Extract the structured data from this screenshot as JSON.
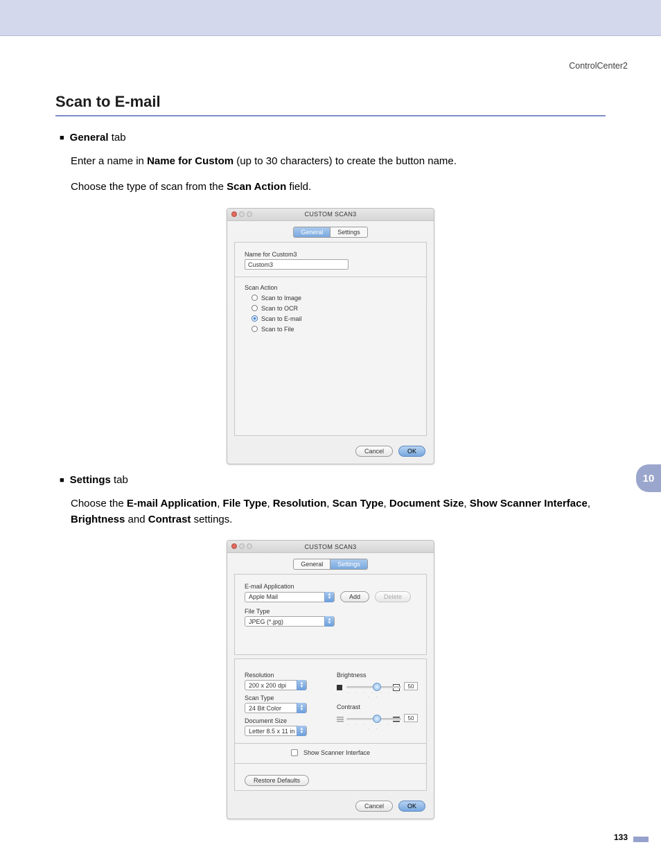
{
  "header": {
    "doc_label": "ControlCenter2"
  },
  "section": {
    "title": "Scan to E-mail"
  },
  "bullets": {
    "general": {
      "bold": "General",
      "rest": " tab"
    },
    "settings": {
      "bold": "Settings",
      "rest": " tab"
    }
  },
  "lines": {
    "l1a": "Enter a name in ",
    "l1b": "Name for Custom",
    "l1c": " (up to 30 characters) to create the button name.",
    "l2a": "Choose the type of scan from the ",
    "l2b": "Scan Action",
    "l2c": " field.",
    "l3a": "Choose the ",
    "l3b": "E-mail Application",
    "l3c": ", ",
    "l3d": "File Type",
    "l3e": ", ",
    "l3f": "Resolution",
    "l3g": ", ",
    "l3h": "Scan Type",
    "l3i": ", ",
    "l3j": "Document Size",
    "l3k": ", ",
    "l3l": "Show Scanner Interface",
    "l3m": ", ",
    "l3n": "Brightness",
    "l3o": " and ",
    "l3p": "Contrast",
    "l3q": " settings."
  },
  "dlg1": {
    "title": "CUSTOM SCAN3",
    "tabs": {
      "general": "General",
      "settings": "Settings"
    },
    "name_label": "Name for Custom3",
    "name_value": "Custom3",
    "scan_action_label": "Scan Action",
    "radios": {
      "image": "Scan to Image",
      "ocr": "Scan to OCR",
      "email": "Scan to E-mail",
      "file": "Scan to File"
    },
    "cancel": "Cancel",
    "ok": "OK"
  },
  "dlg2": {
    "title": "CUSTOM SCAN3",
    "tabs": {
      "general": "General",
      "settings": "Settings"
    },
    "email_app_label": "E-mail Application",
    "email_app_value": "Apple Mail",
    "add": "Add",
    "delete": "Delete",
    "file_type_label": "File Type",
    "file_type_value": "JPEG (*.jpg)",
    "resolution_label": "Resolution",
    "resolution_value": "200 x 200 dpi",
    "scan_type_label": "Scan Type",
    "scan_type_value": "24 Bit Color",
    "doc_size_label": "Document Size",
    "doc_size_value": "Letter  8.5 x 11 in",
    "brightness_label": "Brightness",
    "brightness_value": "50",
    "contrast_label": "Contrast",
    "contrast_value": "50",
    "show_scanner": "Show Scanner Interface",
    "restore": "Restore Defaults",
    "cancel": "Cancel",
    "ok": "OK"
  },
  "side_tab": "10",
  "page_number": "133"
}
